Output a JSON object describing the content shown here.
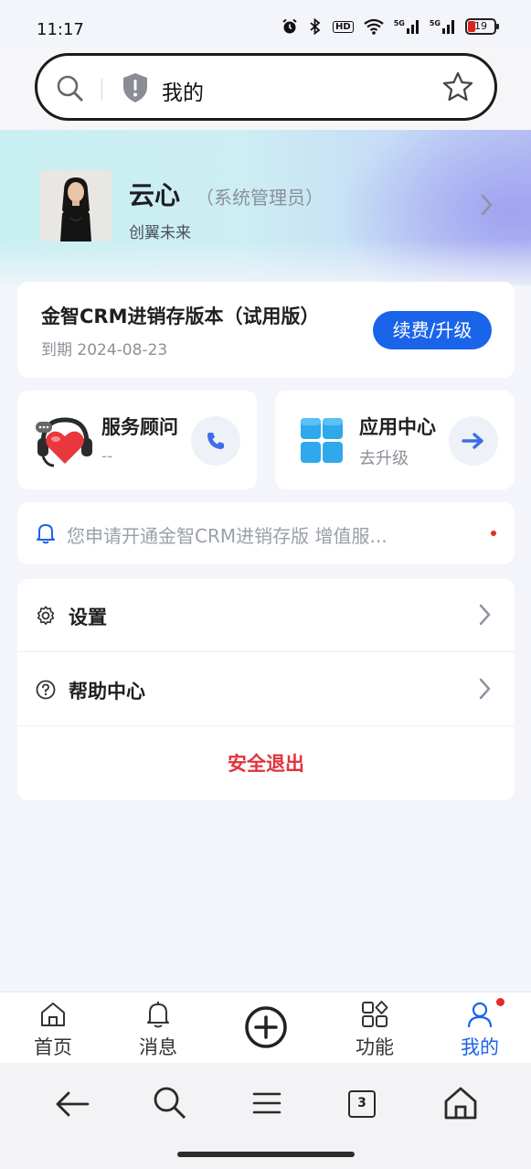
{
  "status_bar": {
    "time": "11:17",
    "network_1": "5G",
    "network_2": "5G",
    "hd_label": "HD",
    "battery_level": "19"
  },
  "browser": {
    "url_text": "我的"
  },
  "profile": {
    "name": "云心",
    "role": "（系统管理员）",
    "company": "创翼未来"
  },
  "license": {
    "title": "金智CRM进销存版本（试用版）",
    "expiry": "到期 2024-08-23",
    "renew_label": "续费/升级"
  },
  "service": {
    "title": "服务顾问",
    "subtitle": "--"
  },
  "app_center": {
    "title": "应用中心",
    "subtitle": "去升级"
  },
  "notice": {
    "text": "您申请开通金智CRM进销存版 增值服..."
  },
  "menu": {
    "settings_label": "设置",
    "help_label": "帮助中心",
    "logout_label": "安全退出"
  },
  "tabs": [
    {
      "label": "首页",
      "icon": "home-icon"
    },
    {
      "label": "消息",
      "icon": "bell-icon"
    },
    {
      "label": "",
      "icon": "plus-circle-icon"
    },
    {
      "label": "功能",
      "icon": "apps-icon"
    },
    {
      "label": "我的",
      "icon": "user-icon",
      "active": true
    }
  ],
  "browser_nav": {
    "tab_count": "3"
  },
  "colors": {
    "accent": "#1a64ea",
    "danger": "#e1323b",
    "background": "#f3f5fb"
  }
}
